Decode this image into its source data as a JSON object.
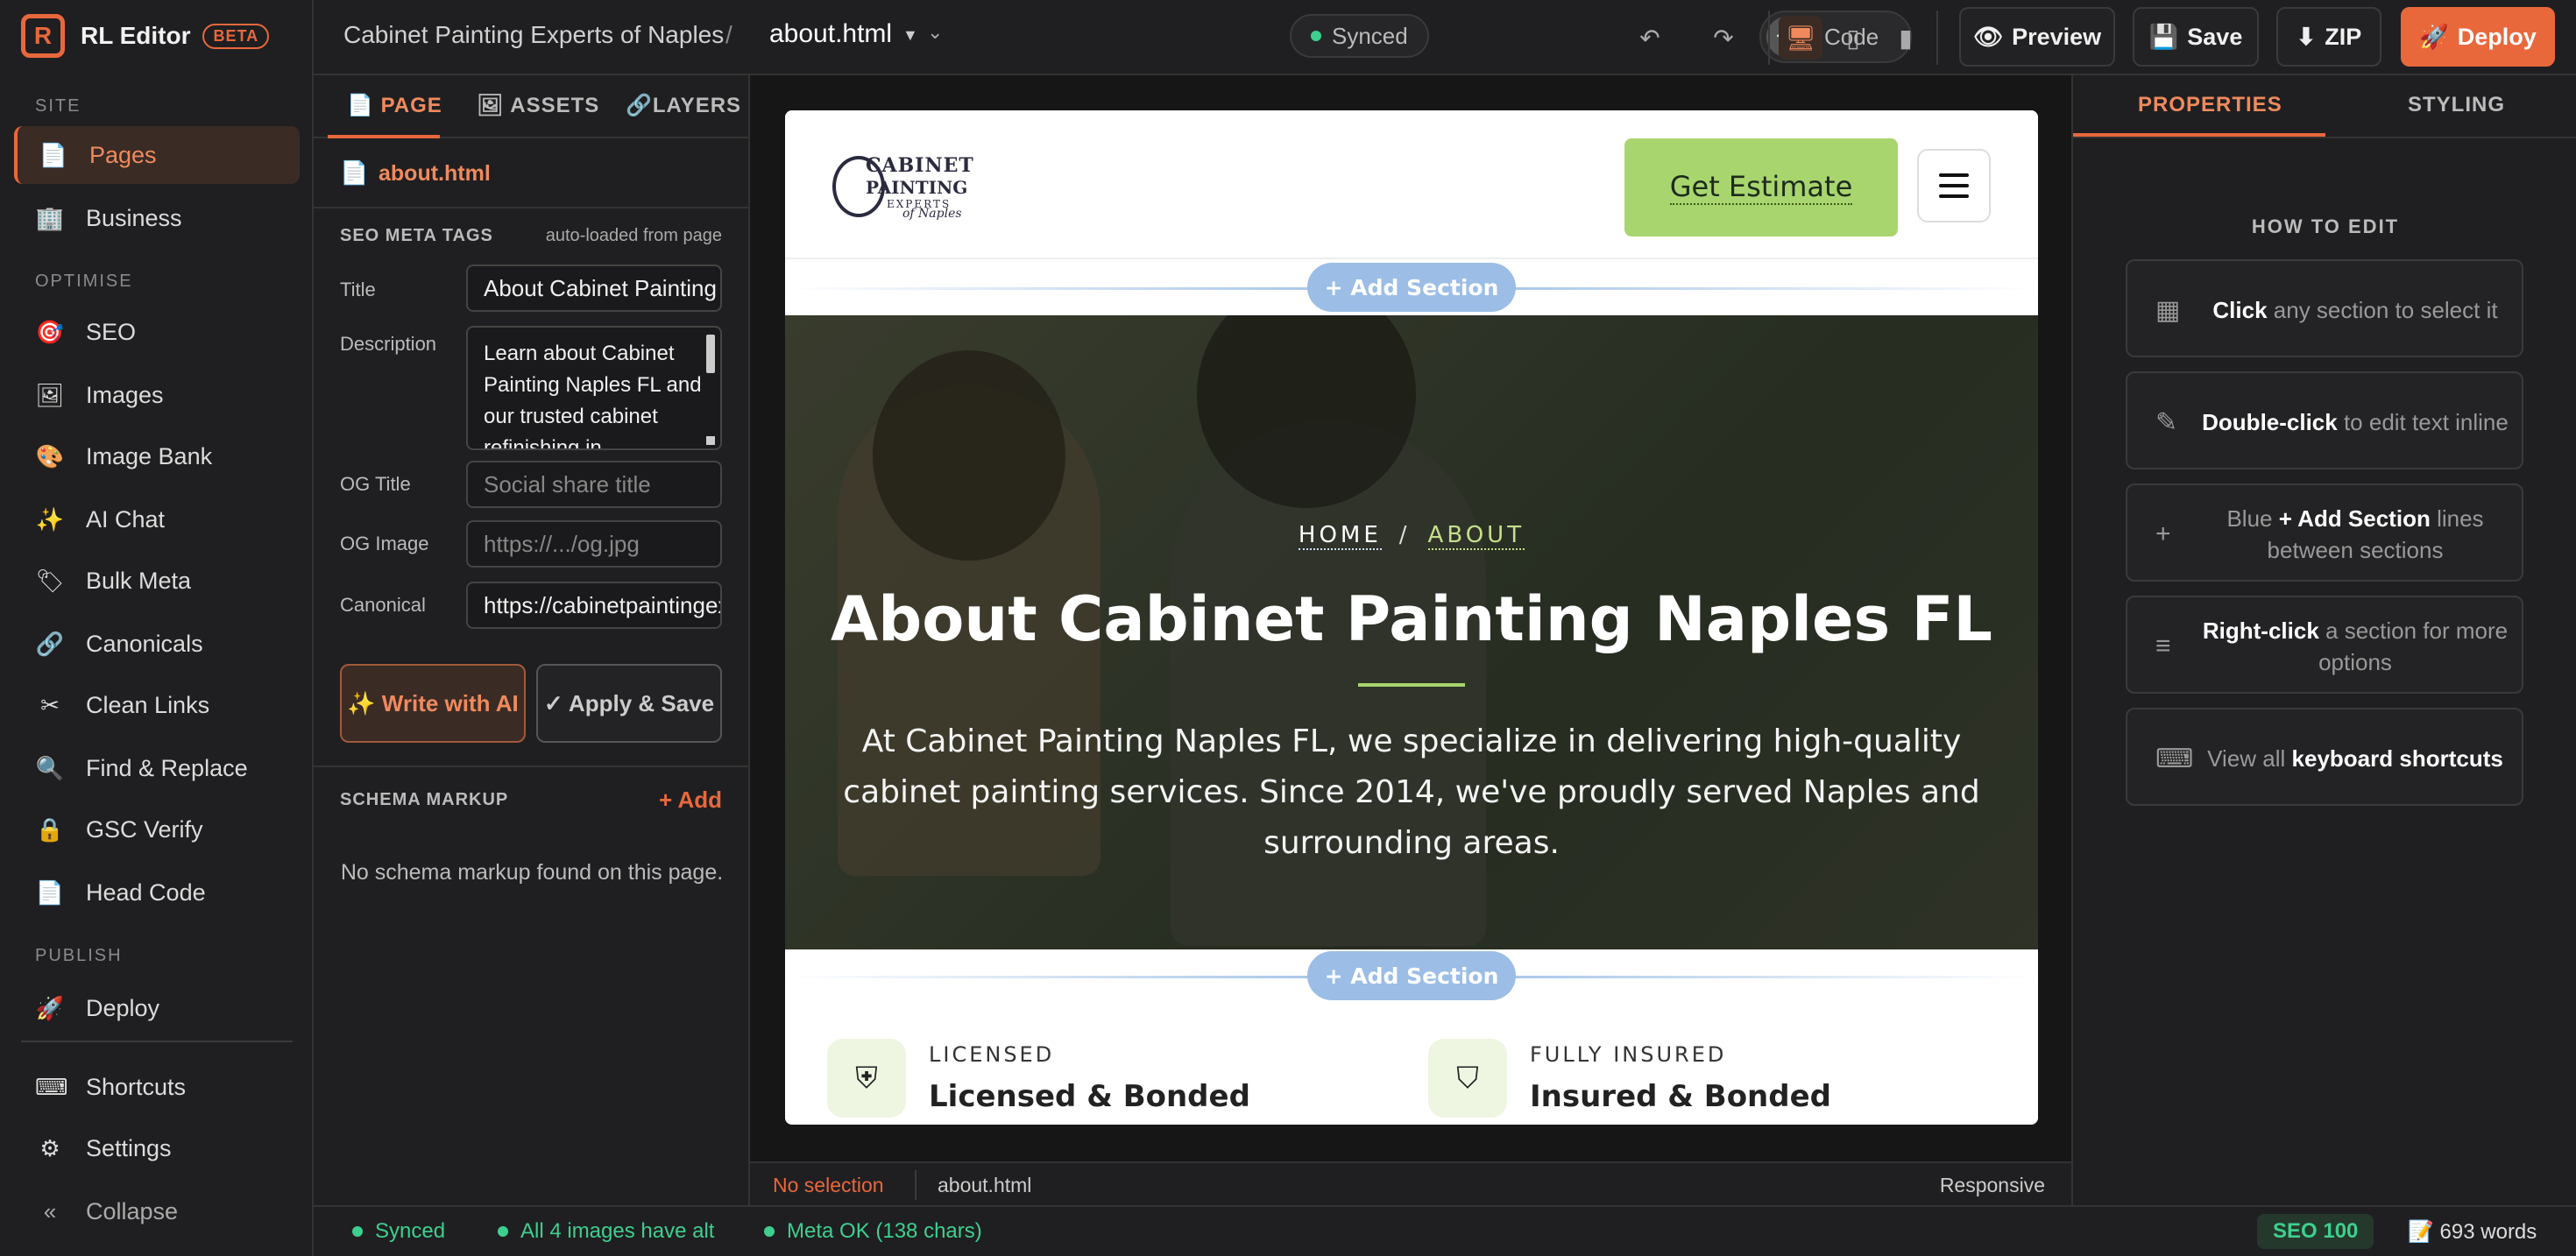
{
  "app": {
    "title": "RL Editor",
    "badge": "BETA"
  },
  "sidebar": {
    "sections": {
      "site": "SITE",
      "optimise": "OPTIMISE",
      "publish": "PUBLISH"
    },
    "items": [
      {
        "label": "Pages",
        "icon": "page-icon"
      },
      {
        "label": "Business",
        "icon": "building-icon"
      },
      {
        "label": "SEO",
        "icon": "target-icon"
      },
      {
        "label": "Images",
        "icon": "image-icon"
      },
      {
        "label": "Image Bank",
        "icon": "palette-icon"
      },
      {
        "label": "AI Chat",
        "icon": "sparkles-icon"
      },
      {
        "label": "Bulk Meta",
        "icon": "tag-icon"
      },
      {
        "label": "Canonicals",
        "icon": "link-icon"
      },
      {
        "label": "Clean Links",
        "icon": "scissors-icon"
      },
      {
        "label": "Find & Replace",
        "icon": "magnifier-icon"
      },
      {
        "label": "GSC Verify",
        "icon": "lock-icon"
      },
      {
        "label": "Head Code",
        "icon": "page-icon"
      },
      {
        "label": "Deploy",
        "icon": "rocket-icon"
      },
      {
        "label": "Shortcuts",
        "icon": "keyboard-icon"
      },
      {
        "label": "Settings",
        "icon": "gear-icon"
      },
      {
        "label": "Collapse",
        "icon": "double-chevron-left-icon"
      }
    ]
  },
  "topbar": {
    "site_name": "Cabinet Painting Experts of Naples",
    "separator": "/",
    "file": "about.html",
    "synced": "Synced",
    "code_label": "Code",
    "preview": "Preview",
    "save": "Save",
    "zip": "ZIP",
    "deploy": "Deploy"
  },
  "left_panel": {
    "tabs": [
      "PAGE",
      "ASSETS",
      "LAYERS"
    ],
    "file": "about.html",
    "seo_meta_heading": "SEO META TAGS",
    "seo_meta_note": "auto-loaded from page",
    "fields": {
      "title_label": "Title",
      "title_value": "About Cabinet Painting Naples FL",
      "description_label": "Description",
      "description_value": "Learn about Cabinet Painting Naples FL and our trusted cabinet refinishing in",
      "og_title_label": "OG Title",
      "og_title_placeholder": "Social share title",
      "og_image_label": "OG Image",
      "og_image_placeholder": "https://.../og.jpg",
      "canonical_label": "Canonical",
      "canonical_value": "https://cabinetpaintingexpertsofnaples.com"
    },
    "write_ai": "✨ Write with AI",
    "apply_save": "✓ Apply & Save",
    "schema_heading": "SCHEMA MARKUP",
    "schema_add": "+ Add",
    "schema_empty": "No schema markup found on this page."
  },
  "preview": {
    "logo_line1": "CABINET",
    "logo_line2": "PAINTING",
    "logo_line3": "EXPERTS",
    "logo_line4": "of Naples",
    "cta": "Get Estimate",
    "add_section": "+ Add Section",
    "breadcrumb_home": "HOME",
    "breadcrumb_sep": "/",
    "breadcrumb_about": "ABOUT",
    "hero_title": "About Cabinet Painting Naples FL",
    "hero_text": "At Cabinet Painting Naples FL, we specialize in delivering high-quality cabinet painting services. Since 2014, we've proudly served Naples and surrounding areas.",
    "features": [
      {
        "label": "LICENSED",
        "title": "Licensed & Bonded"
      },
      {
        "label": "FULLY INSURED",
        "title": "Insured & Bonded"
      }
    ]
  },
  "canvas_status": {
    "selection": "No selection",
    "file": "about.html",
    "mode": "Responsive"
  },
  "right_panel": {
    "tabs": [
      "PROPERTIES",
      "STYLING"
    ],
    "heading": "HOW TO EDIT",
    "tips": [
      {
        "bold": "Click",
        "text": " any section to select it",
        "icon": "grid-icon"
      },
      {
        "bold": "Double-click",
        "text": " to edit text inline",
        "icon": "pencil-icon"
      },
      {
        "pre": "Blue ",
        "bold": "+ Add Section",
        "text": " lines between sections",
        "icon": "plus-icon"
      },
      {
        "bold": "Right-click",
        "text": " a section for more options",
        "icon": "menu-icon"
      },
      {
        "pre": "View all ",
        "bold": "keyboard shortcuts",
        "text": "",
        "icon": "keyboard-icon"
      }
    ]
  },
  "bottom_bar": {
    "synced": "Synced",
    "images_alt": "All 4 images have alt",
    "meta_ok": "Meta OK (138 chars)",
    "seo_score": "SEO 100",
    "words": "📝 693 words"
  },
  "colors": {
    "accent": "#e8683c",
    "success": "#3ecf8e",
    "cta_green": "#a9d56e",
    "add_section_blue": "#9bbde6"
  }
}
